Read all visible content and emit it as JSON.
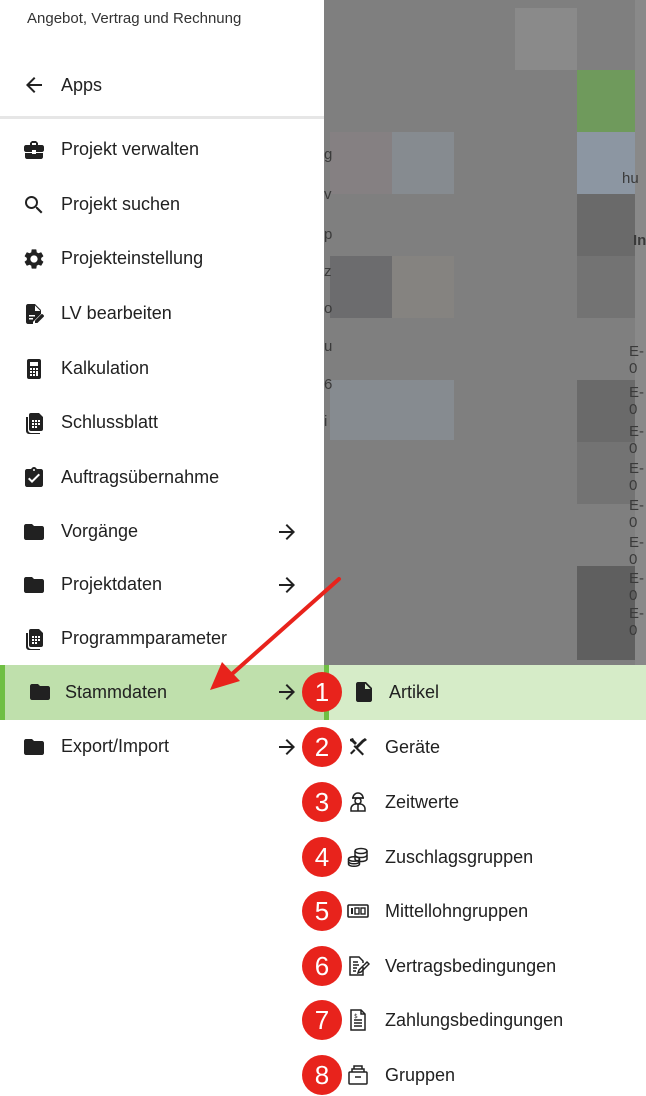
{
  "header": {
    "title": "Angebot, Vertrag und Rechnung"
  },
  "apps": {
    "label": "Apps"
  },
  "menu": {
    "items": [
      {
        "label": "Projekt verwalten"
      },
      {
        "label": "Projekt suchen"
      },
      {
        "label": "Projekteinstellung"
      },
      {
        "label": "LV bearbeiten"
      },
      {
        "label": "Kalkulation"
      },
      {
        "label": "Schlussblatt"
      },
      {
        "label": "Auftragsübernahme"
      },
      {
        "label": "Vorgänge"
      },
      {
        "label": "Projektdaten"
      },
      {
        "label": "Programmparameter"
      },
      {
        "label": "Stammdaten"
      },
      {
        "label": "Export/Import"
      }
    ]
  },
  "submenu": {
    "items": [
      {
        "number": "1",
        "label": "Artikel"
      },
      {
        "number": "2",
        "label": "Geräte"
      },
      {
        "number": "3",
        "label": "Zeitwerte"
      },
      {
        "number": "4",
        "label": "Zuschlagsgruppen"
      },
      {
        "number": "5",
        "label": "Mittellohngruppen"
      },
      {
        "number": "6",
        "label": "Vertragsbedingungen"
      },
      {
        "number": "7",
        "label": "Zahlungsbedingungen"
      },
      {
        "number": "8",
        "label": "Gruppen"
      }
    ]
  },
  "background": {
    "fragments": [
      "g",
      "v",
      "p",
      "z",
      "o",
      "u",
      "6",
      "i",
      "hu",
      "In",
      "E-0",
      "E-0",
      "E-0",
      "E-0",
      "E-0",
      "E-0",
      "E-0",
      "E-0"
    ]
  },
  "colors": {
    "active_bg": "#bfe0ac",
    "active_border": "#6fbf43",
    "badge": "#e8231c",
    "arrow": "#e8231c"
  }
}
